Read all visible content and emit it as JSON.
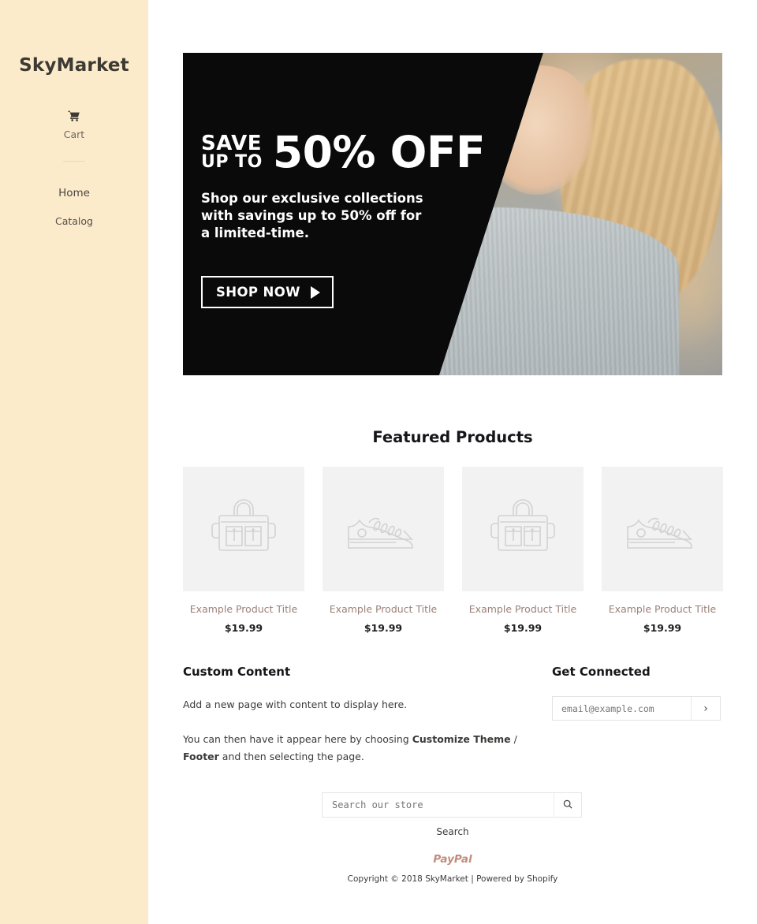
{
  "sidebar": {
    "site_title": "SkyMarket",
    "cart": {
      "icon": "shopping-cart-icon",
      "label": "Cart"
    },
    "nav": [
      {
        "label": "Home"
      },
      {
        "label": "Catalog"
      }
    ]
  },
  "hero": {
    "save_word": "SAVE",
    "up_to_word": "UP TO",
    "percent_off": "50% OFF",
    "subtext": "Shop our exclusive collections with savings up to 50% off for a limited-time.",
    "cta_label": "SHOP NOW",
    "cta_icon": "play-triangle-icon",
    "image_alt": "blonde-model-gray-sweater-photo",
    "background_color": "#0a0a0a"
  },
  "featured": {
    "heading": "Featured Products",
    "products": [
      {
        "icon": "bag-placeholder-icon",
        "title": "Example Product Title",
        "price": "$19.99"
      },
      {
        "icon": "sneaker-placeholder-icon",
        "title": "Example Product Title",
        "price": "$19.99"
      },
      {
        "icon": "bag-placeholder-icon",
        "title": "Example Product Title",
        "price": "$19.99"
      },
      {
        "icon": "sneaker-placeholder-icon",
        "title": "Example Product Title",
        "price": "$19.99"
      }
    ]
  },
  "custom_content": {
    "heading": "Custom Content",
    "paragraph1": "Add a new page with content to display here.",
    "paragraph2_pre": "You can then have it appear here by choosing ",
    "paragraph2_bold1": "Customize Theme",
    "paragraph2_mid": " / ",
    "paragraph2_bold2": "Footer",
    "paragraph2_post": " and then selecting the page."
  },
  "get_connected": {
    "heading": "Get Connected",
    "email_placeholder": "email@example.com",
    "email_value": "",
    "submit_icon": "chevron-right-icon"
  },
  "footer": {
    "search_placeholder": "Search our store",
    "search_value": "",
    "search_icon": "magnifier-icon",
    "search_link_label": "Search",
    "payment_logo": "PayPal",
    "copyright": "Copyright © 2018 SkyMarket | Powered by Shopify"
  },
  "colors": {
    "sidebar_bg": "#fcebcb",
    "product_title": "#9b8178",
    "paypal": "#c08c7d",
    "thumb_bg": "#f2f2f2"
  }
}
